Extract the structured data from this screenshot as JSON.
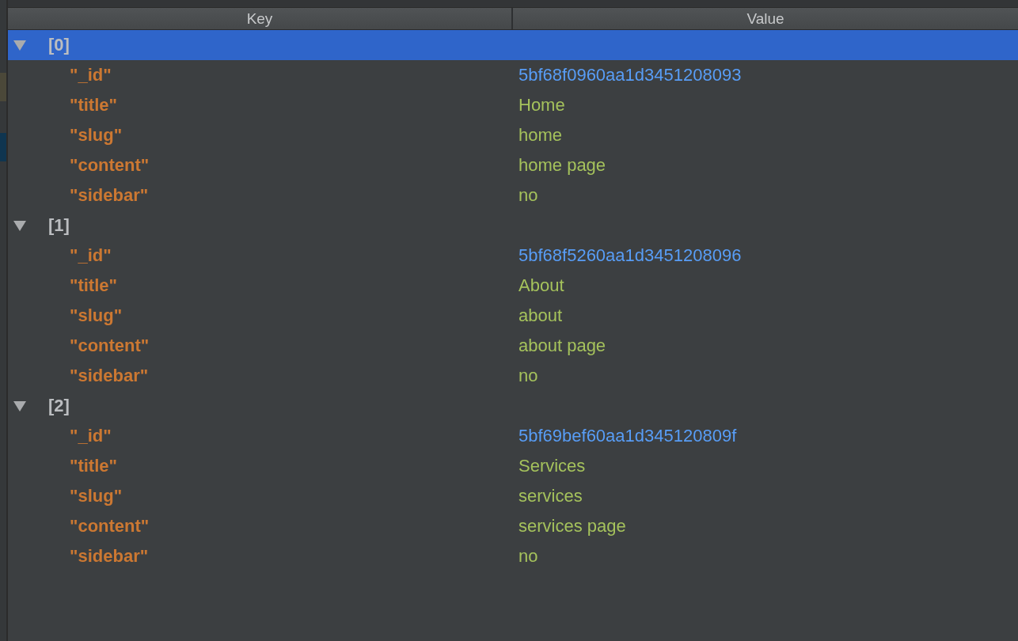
{
  "table": {
    "columns": [
      "Key",
      "Value"
    ],
    "rows": [
      {
        "label": "[0]",
        "expanded": true,
        "selected": true,
        "children": [
          {
            "key": "\"_id\"",
            "value": "5bf68f0960aa1d3451208093",
            "kind": "id"
          },
          {
            "key": "\"title\"",
            "value": "Home",
            "kind": "string"
          },
          {
            "key": "\"slug\"",
            "value": "home",
            "kind": "string"
          },
          {
            "key": "\"content\"",
            "value": "home page",
            "kind": "string"
          },
          {
            "key": "\"sidebar\"",
            "value": "no",
            "kind": "string"
          }
        ]
      },
      {
        "label": "[1]",
        "expanded": true,
        "selected": false,
        "children": [
          {
            "key": "\"_id\"",
            "value": "5bf68f5260aa1d3451208096",
            "kind": "id"
          },
          {
            "key": "\"title\"",
            "value": "About",
            "kind": "string"
          },
          {
            "key": "\"slug\"",
            "value": "about",
            "kind": "string"
          },
          {
            "key": "\"content\"",
            "value": "about page",
            "kind": "string"
          },
          {
            "key": "\"sidebar\"",
            "value": "no",
            "kind": "string"
          }
        ]
      },
      {
        "label": "[2]",
        "expanded": true,
        "selected": false,
        "children": [
          {
            "key": "\"_id\"",
            "value": "5bf69bef60aa1d345120809f",
            "kind": "id"
          },
          {
            "key": "\"title\"",
            "value": "Services",
            "kind": "string"
          },
          {
            "key": "\"slug\"",
            "value": "services",
            "kind": "string"
          },
          {
            "key": "\"content\"",
            "value": "services page",
            "kind": "string"
          },
          {
            "key": "\"sidebar\"",
            "value": "no",
            "kind": "string"
          }
        ]
      }
    ]
  }
}
